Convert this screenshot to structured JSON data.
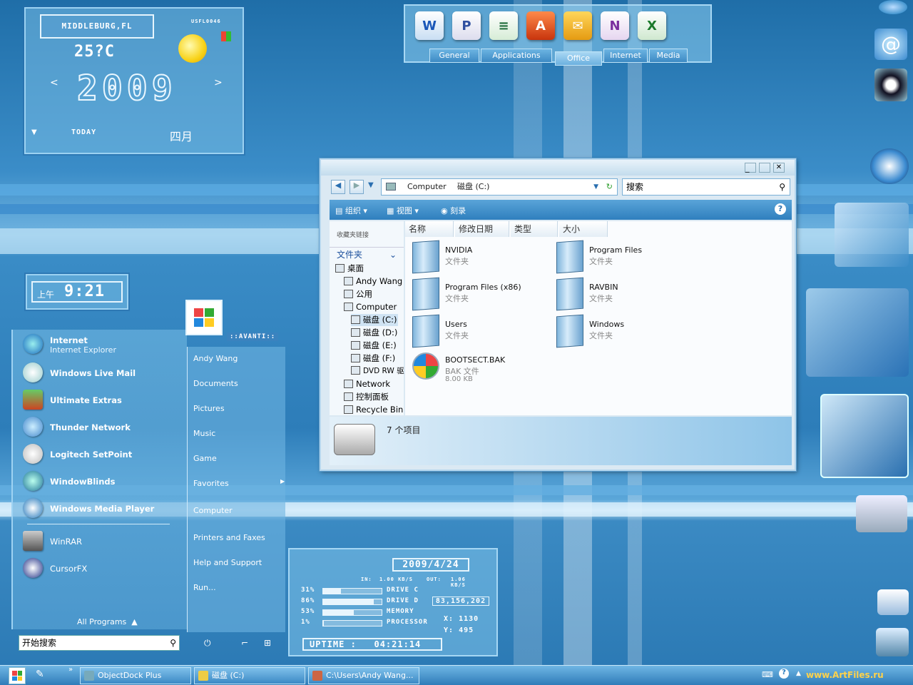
{
  "weather": {
    "location": "MIDDLEBURG,FL",
    "code": "USFL0046",
    "temperature": "25?C",
    "year": "2009",
    "prev": "<",
    "next": ">",
    "today_label": "TODAY",
    "month": "四月"
  },
  "clock": {
    "ampm": "上午",
    "time": "9:21"
  },
  "dock": {
    "tabs": [
      "General",
      "Applications",
      "Office",
      "Internet",
      "Media"
    ],
    "active_tab": "Office",
    "icons": [
      "word-icon",
      "project-icon",
      "publisher-icon",
      "access-icon",
      "outlook-icon",
      "onenote-icon",
      "excel-icon"
    ]
  },
  "explorer": {
    "address": [
      "Computer",
      "磁盘 (C:)"
    ],
    "search_placeholder": "搜索",
    "commands": [
      "组织",
      "视图",
      "刻录"
    ],
    "favorites_label": "收藏夹链接",
    "folders_label": "文件夹",
    "tree": [
      "桌面",
      "Andy Wang",
      "公用",
      "Computer",
      "磁盘 (C:)",
      "磁盘 (D:)",
      "磁盘 (E:)",
      "磁盘 (F:)",
      "DVD RW 驱",
      "Network",
      "控制面板",
      "Recycle Bin"
    ],
    "columns": [
      "名称",
      "修改日期",
      "类型",
      "大小"
    ],
    "files": [
      {
        "name": "NVIDIA",
        "type": "文件夹"
      },
      {
        "name": "Program Files",
        "type": "文件夹"
      },
      {
        "name": "Program Files (x86)",
        "type": "文件夹"
      },
      {
        "name": "RAVBIN",
        "type": "文件夹"
      },
      {
        "name": "Users",
        "type": "文件夹"
      },
      {
        "name": "Windows",
        "type": "文件夹"
      },
      {
        "name": "BOOTSECT.BAK",
        "type": "BAK 文件",
        "size": "8.00 KB"
      }
    ],
    "item_count": "7 个项目"
  },
  "startmenu": {
    "programs": [
      {
        "title": "Internet",
        "sub": "Internet Explorer"
      },
      {
        "title": "Windows Live Mail"
      },
      {
        "title": "Ultimate Extras"
      },
      {
        "title": "Thunder Network"
      },
      {
        "title": "Logitech SetPoint"
      },
      {
        "title": "WindowBlinds"
      },
      {
        "title": "Windows Media Player"
      },
      {
        "title": "WinRAR"
      },
      {
        "title": "CursorFX"
      }
    ],
    "all_programs": "All Programs",
    "search_placeholder": "开始搜索",
    "brand": "::AVANTI::",
    "right": [
      "Andy Wang",
      "Documents",
      "Pictures",
      "Music",
      "Game",
      "Favorites",
      "Computer",
      "Printers and Faxes",
      "Help and Support",
      "Run..."
    ]
  },
  "sysmon": {
    "date": "2009/4/24",
    "in_label": "IN:",
    "in": "1.00 KB/S",
    "out_label": "OUT:",
    "out": "1.06 KB/S",
    "rows": [
      {
        "pct": "31%",
        "label": "DRIVE C",
        "level": 0.31
      },
      {
        "pct": "86%",
        "label": "DRIVE D",
        "level": 0.86
      },
      {
        "pct": "53%",
        "label": "MEMORY",
        "level": 0.53
      },
      {
        "pct": "1%",
        "label": "PROCESSOR",
        "level": 0.01
      }
    ],
    "bytes": "83,156,202",
    "x_label": "X:",
    "x": "1130",
    "y_label": "Y:",
    "y": "495",
    "uptime_label": "UPTIME :",
    "uptime": "04:21:14"
  },
  "taskbar": {
    "buttons": [
      "ObjectDock Plus",
      "磁盘 (C:)",
      "C:\\Users\\Andy Wang..."
    ],
    "watermark": "www.ArtFiles.ru"
  }
}
